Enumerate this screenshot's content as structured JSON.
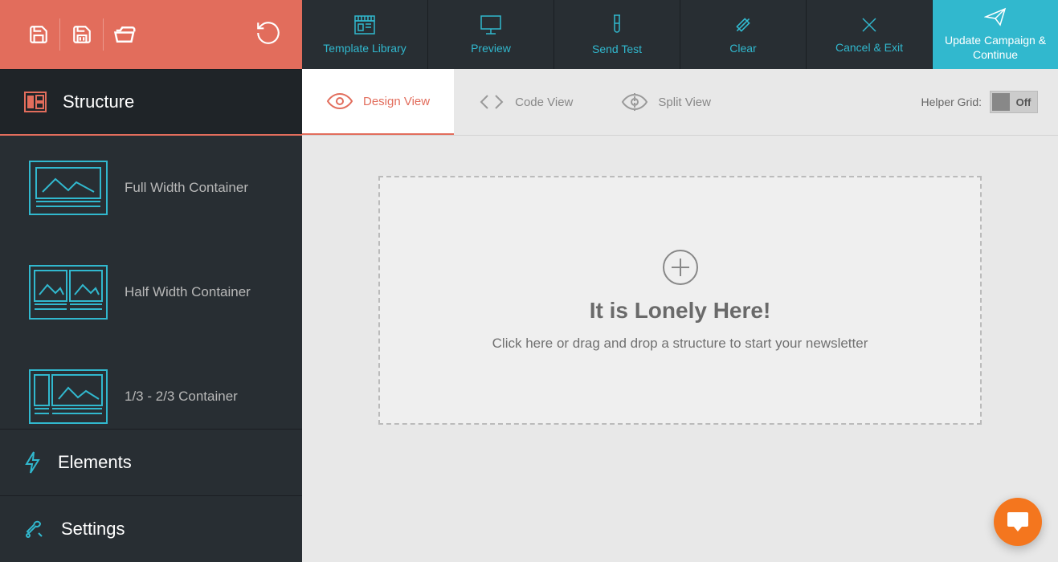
{
  "toolbar": {
    "template_library": "Template Library",
    "preview": "Preview",
    "send_test": "Send Test",
    "clear": "Clear",
    "cancel_exit": "Cancel & Exit",
    "update_continue": "Update Campaign & Continue"
  },
  "sidebar": {
    "sections": {
      "structure": "Structure",
      "elements": "Elements",
      "settings": "Settings"
    },
    "components": [
      {
        "label": "Full Width Container"
      },
      {
        "label": "Half Width Container"
      },
      {
        "label": "1/3 - 2/3 Container"
      }
    ]
  },
  "view_tabs": {
    "design": "Design View",
    "code": "Code View",
    "split": "Split View",
    "helper_grid_label": "Helper Grid:",
    "helper_grid_state": "Off"
  },
  "canvas": {
    "empty_title": "It is Lonely Here!",
    "empty_subtitle": "Click here or drag and drop a structure to start your newsletter"
  }
}
